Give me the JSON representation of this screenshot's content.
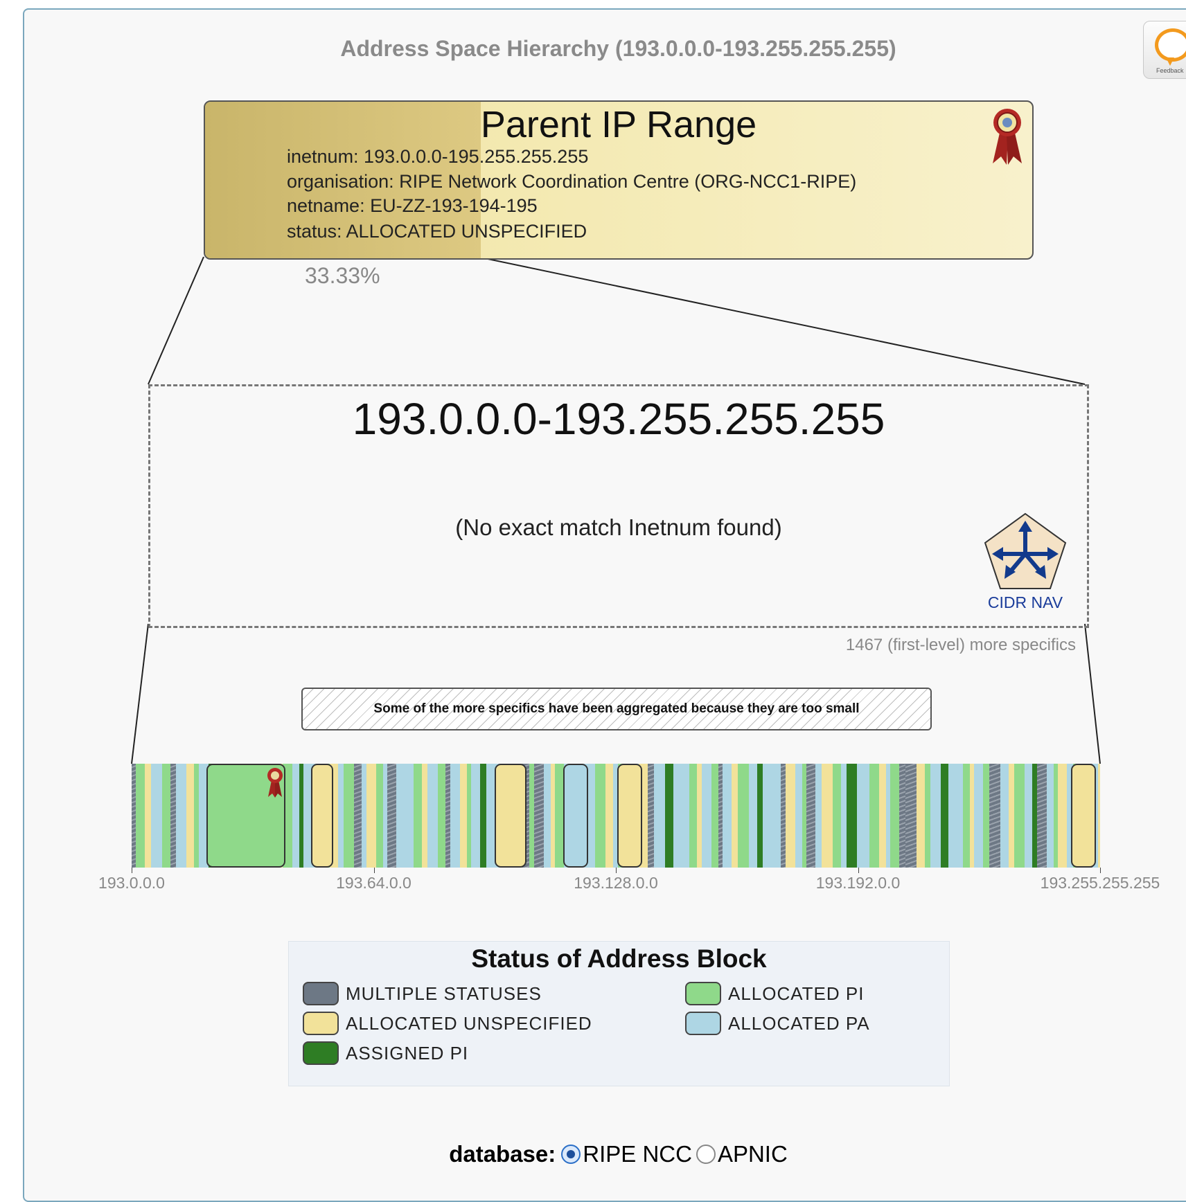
{
  "title": "Address Space Hierarchy (193.0.0.0-193.255.255.255)",
  "feedback": {
    "label": "Feedback"
  },
  "parent": {
    "heading": "Parent IP Range",
    "inetnum": "inetnum: 193.0.0.0-195.255.255.255",
    "organisation": "organisation: RIPE Network Coordination Centre (ORG-NCC1-RIPE)",
    "netname": "netname: EU-ZZ-193-194-195",
    "status": "status: ALLOCATED UNSPECIFIED",
    "share_pct": 33.33,
    "share_label": "33.33%"
  },
  "range": {
    "title": "193.0.0.0-193.255.255.255",
    "message": "(No exact match Inetnum found)",
    "nav_label": "CIDR NAV"
  },
  "specifics_count": "1467 (first-level) more specifics",
  "aggregation_note": "Some of the more specifics have been aggregated because they are too small",
  "axis": {
    "ticks": [
      "193.0.0.0",
      "193.64.0.0",
      "193.128.0.0",
      "193.192.0.0",
      "193.255.255.255"
    ]
  },
  "legend": {
    "title": "Status of Address Block",
    "items": [
      {
        "label": "MULTIPLE STATUSES",
        "color": "#6d7885"
      },
      {
        "label": "ALLOCATED PI",
        "color": "#8fd98a"
      },
      {
        "label": "ALLOCATED UNSPECIFIED",
        "color": "#f2e29a"
      },
      {
        "label": "ALLOCATED PA",
        "color": "#aed6e4"
      },
      {
        "label": "ASSIGNED PI",
        "color": "#2e7d24"
      }
    ]
  },
  "database": {
    "label": "database:",
    "options": [
      {
        "label": "RIPE NCC",
        "selected": true
      },
      {
        "label": "APNIC",
        "selected": false
      }
    ]
  },
  "colors": {
    "multiple": "#6d7885",
    "alloc_pi": "#8fd98a",
    "alloc_unspec": "#f2e29a",
    "alloc_pa": "#aed6e4",
    "assigned_pi": "#2e7d24",
    "accent": "#1a3c9a"
  }
}
